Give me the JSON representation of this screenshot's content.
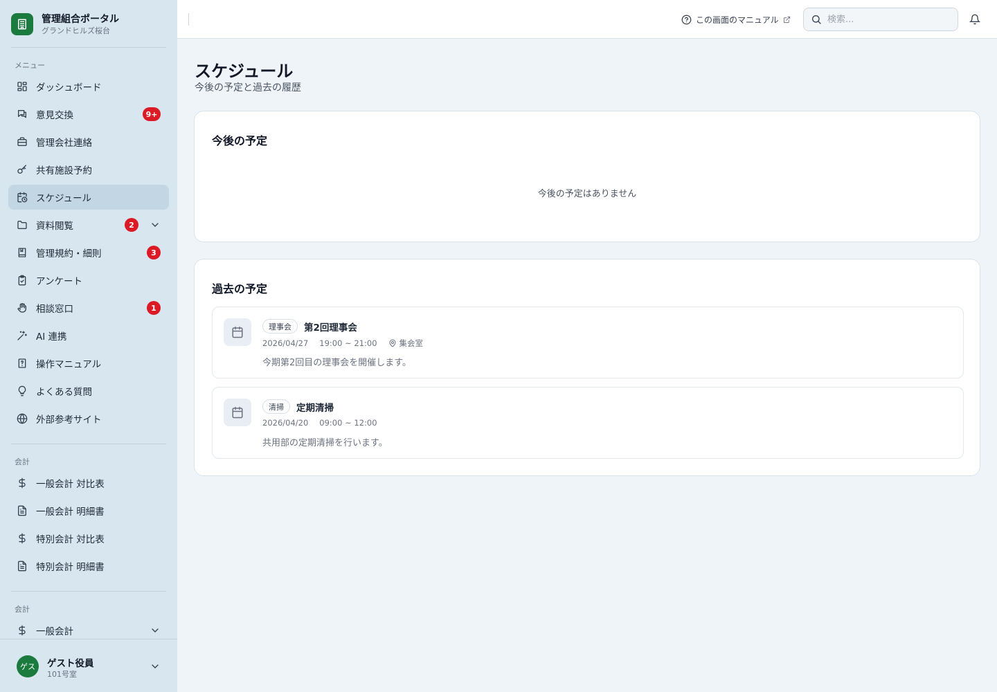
{
  "brand": {
    "title": "管理組合ポータル",
    "subtitle": "グランドヒルズ桜台"
  },
  "colors": {
    "brand": "#1b7a3e",
    "badge": "#dc1a26",
    "sidebar_bg": "#d8e6f0",
    "active_bg": "#c2d6e4"
  },
  "sidebar": {
    "menu_label": "メニュー",
    "items": [
      {
        "label": "ダッシュボード",
        "icon": "dashboard-icon"
      },
      {
        "label": "意見交換",
        "icon": "chat-icon",
        "badge": "9+"
      },
      {
        "label": "管理会社連絡",
        "icon": "briefcase-icon"
      },
      {
        "label": "共有施設予約",
        "icon": "key-icon"
      },
      {
        "label": "スケジュール",
        "icon": "calendar-clock-icon",
        "active": true
      },
      {
        "label": "資料閲覧",
        "icon": "folder-icon",
        "badge": "2",
        "expandable": true
      },
      {
        "label": "管理規約・細則",
        "icon": "book-icon",
        "badge": "3"
      },
      {
        "label": "アンケート",
        "icon": "clipboard-icon"
      },
      {
        "label": "相談窓口",
        "icon": "hand-icon",
        "badge": "1"
      },
      {
        "label": "AI 連携",
        "icon": "sparkle-wand-icon"
      },
      {
        "label": "操作マニュアル",
        "icon": "manual-icon"
      },
      {
        "label": "よくある質問",
        "icon": "lightbulb-icon"
      },
      {
        "label": "外部参考サイト",
        "icon": "globe-icon"
      }
    ],
    "accounting_label": "会計",
    "accounting_items": [
      {
        "label": "一般会計 対比表",
        "icon": "dollar-icon"
      },
      {
        "label": "一般会計 明細書",
        "icon": "document-icon"
      },
      {
        "label": "特別会計 対比表",
        "icon": "dollar-icon"
      },
      {
        "label": "特別会計 明細書",
        "icon": "document-icon"
      }
    ],
    "accounting2_label": "会計",
    "accounting2_items": [
      {
        "label": "一般会計",
        "icon": "dollar-icon",
        "expandable": true
      }
    ]
  },
  "user": {
    "avatar": "ゲス",
    "name": "ゲスト役員",
    "room": "101号室"
  },
  "header": {
    "manual_link": "この画面のマニュアル",
    "search_placeholder": "検索..."
  },
  "page": {
    "title": "スケジュール",
    "subtitle": "今後の予定と過去の履歴"
  },
  "upcoming": {
    "title": "今後の予定",
    "empty": "今後の予定はありません"
  },
  "past": {
    "title": "過去の予定",
    "events": [
      {
        "tag": "理事会",
        "title": "第2回理事会",
        "date": "2026/04/27",
        "time": "19:00 ~ 21:00",
        "location": "集会室",
        "description": "今期第2回目の理事会を開催します。"
      },
      {
        "tag": "清掃",
        "title": "定期清掃",
        "date": "2026/04/20",
        "time": "09:00 ~ 12:00",
        "description": "共用部の定期清掃を行います。"
      }
    ]
  }
}
